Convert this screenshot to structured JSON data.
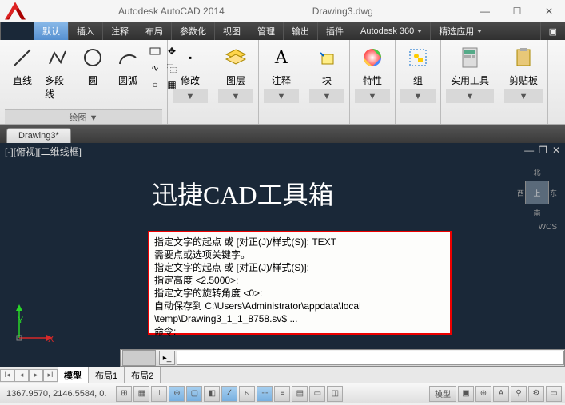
{
  "title": {
    "app": "Autodesk AutoCAD 2014",
    "file": "Drawing3.dwg"
  },
  "menu": {
    "items": [
      "插入",
      "注释",
      "布局",
      "参数化",
      "视图",
      "管理",
      "输出",
      "插件",
      "Autodesk 360",
      "精选应用"
    ],
    "active": "默认"
  },
  "ribbon": {
    "draw": {
      "line": "直线",
      "polyline": "多段线",
      "circle": "圆",
      "arc": "圆弧",
      "footer": "绘图 ▼"
    },
    "modify": {
      "label": "修改",
      "footer": "▼"
    },
    "layer": {
      "label": "图层",
      "footer": "▼"
    },
    "annot": {
      "label": "注释",
      "footer": "▼"
    },
    "block": {
      "label": "块",
      "footer": "▼"
    },
    "prop": {
      "label": "特性",
      "footer": "▼"
    },
    "group": {
      "label": "组",
      "footer": "▼"
    },
    "util": {
      "label": "实用工具",
      "footer": "▼"
    },
    "clip": {
      "label": "剪贴板",
      "footer": "▼"
    }
  },
  "doctab": "Drawing3*",
  "vp_label": "[-][俯视][二维线框]",
  "big_text": "迅捷CAD工具箱",
  "wcs": "WCS",
  "cube_top": "上",
  "cmd_lines": [
    "指定文字的起点 或 [对正(J)/样式(S)]: TEXT",
    "需要点或选项关键字。",
    "指定文字的起点 或 [对正(J)/样式(S)]:",
    "指定高度 <2.5000>:",
    "指定文字的旋转角度 <0>:",
    "自动保存到 C:\\Users\\Administrator\\appdata\\local",
    "\\temp\\Drawing3_1_1_8758.sv$ ...",
    "命令:"
  ],
  "model_tabs": {
    "model": "模型",
    "layout1": "布局1",
    "layout2": "布局2"
  },
  "status": {
    "coords": "1367.9570, 2146.5584, 0.",
    "model": "模型"
  }
}
